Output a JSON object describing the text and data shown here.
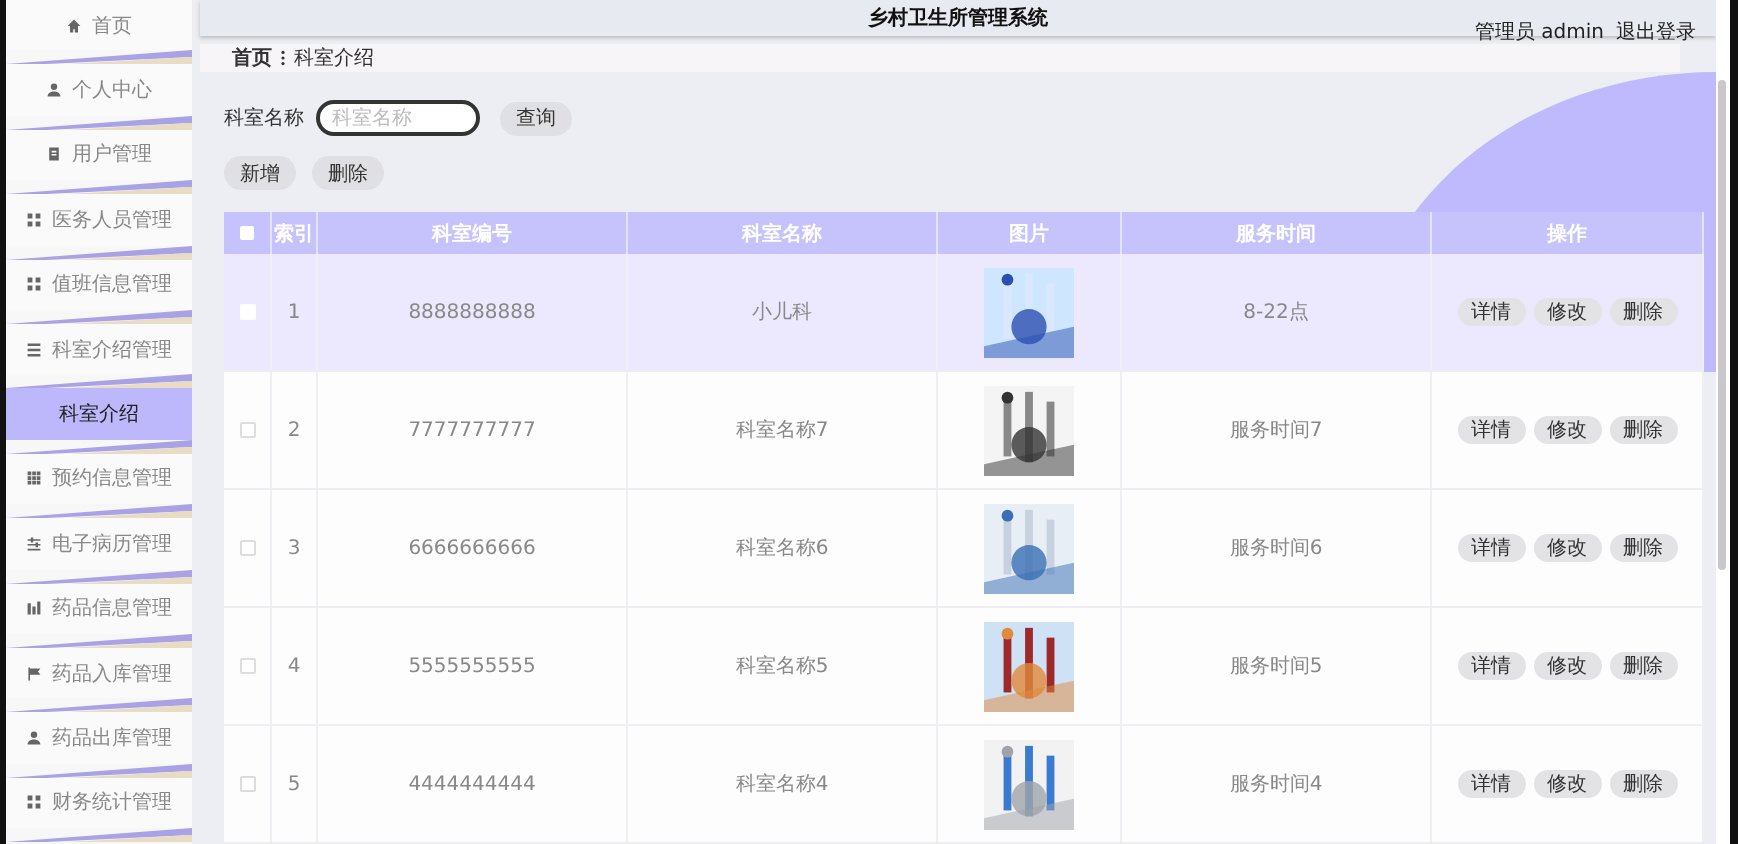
{
  "sidebar": {
    "items": [
      {
        "label": "首页",
        "kind": "menu",
        "selected": false
      },
      {
        "label": "个人中心",
        "kind": "menu",
        "selected": false
      },
      {
        "label": "用户管理",
        "kind": "menu",
        "selected": false
      },
      {
        "label": "医务人员管理",
        "kind": "menu",
        "selected": false
      },
      {
        "label": "值班信息管理",
        "kind": "menu",
        "selected": false
      },
      {
        "label": "科室介绍管理",
        "kind": "menu",
        "selected": false
      },
      {
        "label": "科室介绍",
        "kind": "submenu",
        "selected": true
      },
      {
        "label": "预约信息管理",
        "kind": "menu",
        "selected": false
      },
      {
        "label": "电子病历管理",
        "kind": "menu",
        "selected": false
      },
      {
        "label": "药品信息管理",
        "kind": "menu",
        "selected": false
      },
      {
        "label": "药品入库管理",
        "kind": "menu",
        "selected": false
      },
      {
        "label": "药品出库管理",
        "kind": "menu",
        "selected": false
      },
      {
        "label": "财务统计管理",
        "kind": "menu",
        "selected": false
      }
    ]
  },
  "header": {
    "title": "乡村卫生所管理系统",
    "user": "管理员 admin",
    "logout": "退出登录"
  },
  "breadcrumb": [
    "首页",
    "科室介绍"
  ],
  "search": {
    "label": "科室名称",
    "placeholder": "科室名称",
    "button": "查询"
  },
  "actions": [
    "新增",
    "删除"
  ],
  "table": {
    "select_all": {
      "checked": false
    },
    "columns": [
      "索引",
      "科室编号",
      "科室名称",
      "图片",
      "服务时间",
      "操作"
    ],
    "rows": [
      {
        "index": "1",
        "code": "8888888888",
        "name": "小儿科",
        "time": "8-22点",
        "selected": true,
        "buttons": [
          "详情",
          "修改",
          "删除"
        ]
      },
      {
        "index": "2",
        "code": "7777777777",
        "name": "科室名称7",
        "time": "服务时间7",
        "selected": false,
        "buttons": [
          "详情",
          "修改",
          "删除"
        ]
      },
      {
        "index": "3",
        "code": "6666666666",
        "name": "科室名称6",
        "time": "服务时间6",
        "selected": false,
        "buttons": [
          "详情",
          "修改",
          "删除"
        ]
      },
      {
        "index": "4",
        "code": "5555555555",
        "name": "科室名称5",
        "time": "服务时间5",
        "selected": false,
        "buttons": [
          "详情",
          "修改",
          "删除"
        ]
      },
      {
        "index": "5",
        "code": "4444444444",
        "name": "科室名称4",
        "time": "服务时间4",
        "selected": false,
        "buttons": [
          "详情",
          "修改",
          "删除"
        ]
      }
    ]
  }
}
